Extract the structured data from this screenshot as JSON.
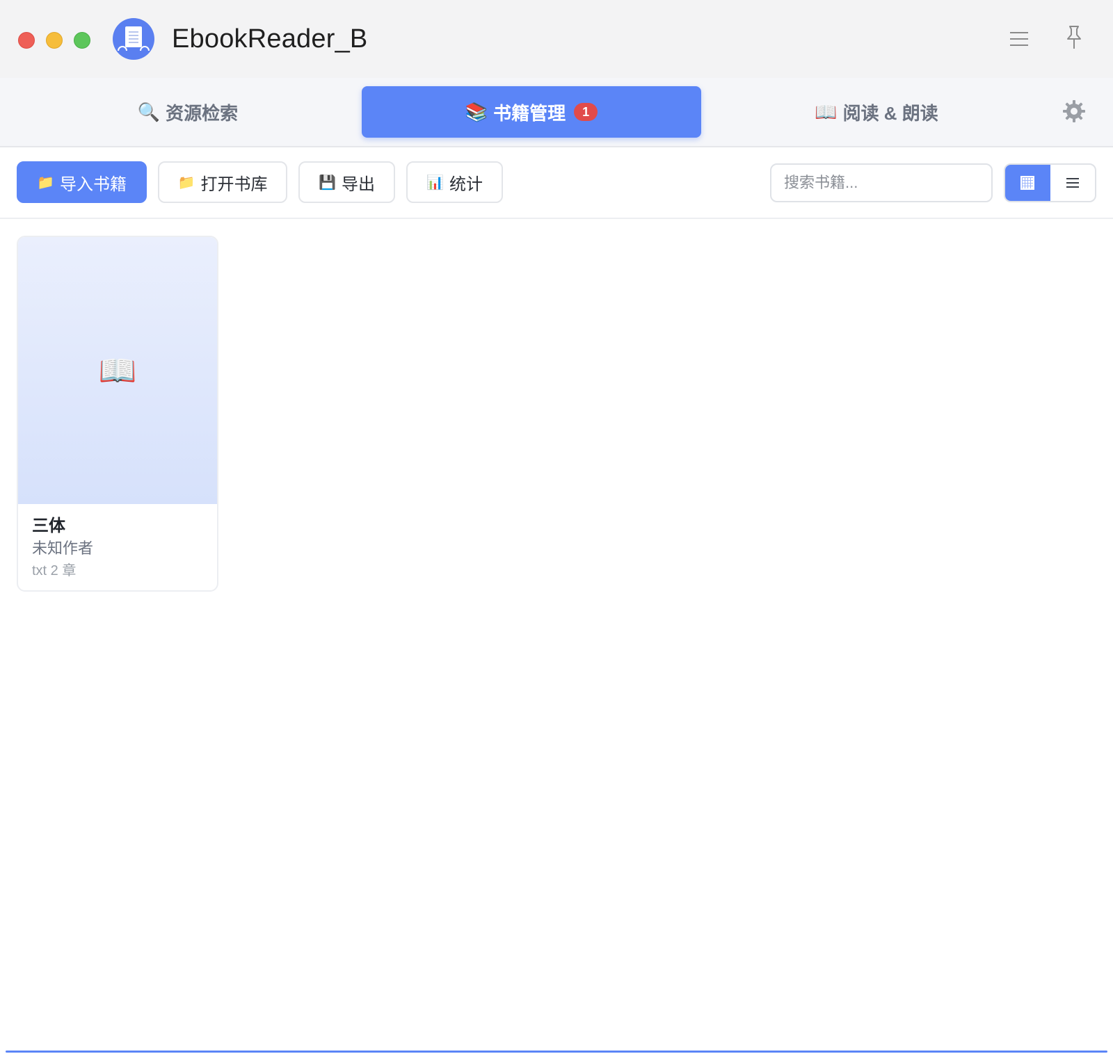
{
  "window": {
    "title": "EbookReader_B"
  },
  "titlebar": {
    "icons": {
      "menu": "hamburger-menu-icon",
      "pin": "pin-icon"
    }
  },
  "tabs": {
    "search": {
      "icon": "🔍",
      "label": "资源检索"
    },
    "manage": {
      "icon": "📚",
      "label": "书籍管理",
      "badge": "1",
      "active": true
    },
    "read": {
      "icon": "📖",
      "label": "阅读 & 朗读"
    },
    "settings_icon": "gear-icon"
  },
  "toolbar": {
    "import": {
      "icon": "📁",
      "label": "导入书籍"
    },
    "open_library": {
      "icon": "📁",
      "label": "打开书库"
    },
    "export": {
      "icon": "💾",
      "label": "导出"
    },
    "stats": {
      "icon": "📊",
      "label": "统计"
    },
    "search_placeholder": "搜索书籍...",
    "view_mode": "grid"
  },
  "books": [
    {
      "cover_icon": "📖",
      "title": "三体",
      "author": "未知作者",
      "meta": "txt 2 章"
    }
  ],
  "colors": {
    "accent": "#5b85f7",
    "badge": "#e14b4b",
    "traffic_red": "#ee5f57",
    "traffic_yellow": "#f6bd3b",
    "traffic_green": "#5dc65b"
  }
}
